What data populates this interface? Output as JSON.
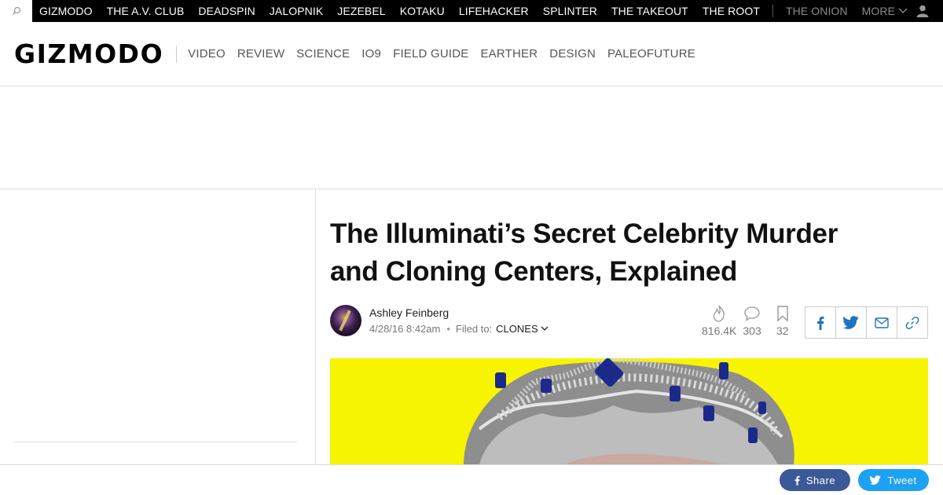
{
  "network": {
    "links": [
      "GIZMODO",
      "THE A.V. CLUB",
      "DEADSPIN",
      "JALOPNIK",
      "JEZEBEL",
      "KOTAKU",
      "LIFEHACKER",
      "SPLINTER",
      "THE TAKEOUT",
      "THE ROOT"
    ],
    "dim_link": "THE ONION",
    "more_label": "MORE",
    "icons": {
      "search": "search-icon",
      "user": "user-icon",
      "more": "chevron-down-icon"
    }
  },
  "header": {
    "logo": "GIZMODO",
    "sections": [
      "VIDEO",
      "REVIEW",
      "SCIENCE",
      "IO9",
      "FIELD GUIDE",
      "EARTHER",
      "DESIGN",
      "PALEOFUTURE"
    ]
  },
  "article": {
    "title": "The Illuminati’s Secret Celebrity Murder and Cloning Centers, Explained",
    "author": "Ashley Feinberg",
    "date": "4/28/16 8:42am",
    "filed_label": "Filed to:",
    "filed_tag": "CLONES",
    "stats": {
      "views": "816.4K",
      "comments": "303",
      "saves": "32"
    },
    "hero_bg": "#f7f400"
  },
  "share": {
    "icons": [
      "facebook-icon",
      "twitter-icon",
      "email-icon",
      "link-icon"
    ],
    "facebook_label": "Share",
    "twitter_label": "Tweet",
    "colors": {
      "facebook": "#3b5998",
      "twitter": "#1da1f2"
    }
  }
}
